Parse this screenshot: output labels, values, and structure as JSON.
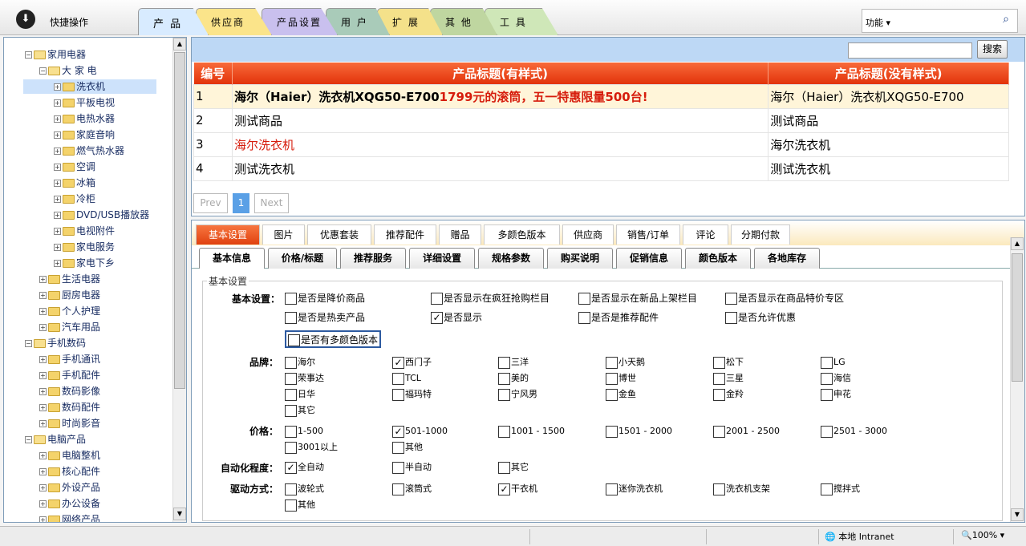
{
  "toolbar": {
    "quick_label": "快捷操作",
    "function_label": "功能 ▾",
    "search_icon": "search-icon"
  },
  "tabs": [
    {
      "label": "产 品",
      "color": "#d8ebff"
    },
    {
      "label": "供应商",
      "color": "#fbe48a"
    },
    {
      "label": "产品设置",
      "color": "#c9c0ee"
    },
    {
      "label": "用 户",
      "color": "#a9cbb9"
    },
    {
      "label": "扩 展",
      "color": "#f4e18a"
    },
    {
      "label": "其 他",
      "color": "#bfd6a0"
    },
    {
      "label": "工 具",
      "color": "#cfe7b8"
    }
  ],
  "tree": {
    "items": [
      {
        "label": "家用电器",
        "level": 0
      },
      {
        "label": "大 家 电",
        "level": 1
      },
      {
        "label": "洗衣机",
        "level": 2
      },
      {
        "label": "平板电视",
        "level": 2
      },
      {
        "label": "电热水器",
        "level": 2
      },
      {
        "label": "家庭音响",
        "level": 2
      },
      {
        "label": "燃气热水器",
        "level": 2
      },
      {
        "label": "空调",
        "level": 2
      },
      {
        "label": "冰箱",
        "level": 2
      },
      {
        "label": "冷柜",
        "level": 2
      },
      {
        "label": "DVD/USB播放器",
        "level": 2
      },
      {
        "label": "电视附件",
        "level": 2
      },
      {
        "label": "家电服务",
        "level": 2
      },
      {
        "label": "家电下乡",
        "level": 2
      },
      {
        "label": "生活电器",
        "level": 1
      },
      {
        "label": "厨房电器",
        "level": 1
      },
      {
        "label": "个人护理",
        "level": 1
      },
      {
        "label": "汽车用品",
        "level": 1
      },
      {
        "label": "手机数码",
        "level": 0
      },
      {
        "label": "手机通讯",
        "level": 1
      },
      {
        "label": "手机配件",
        "level": 1
      },
      {
        "label": "数码影像",
        "level": 1
      },
      {
        "label": "数码配件",
        "level": 1
      },
      {
        "label": "时尚影音",
        "level": 1
      },
      {
        "label": "电脑产品",
        "level": 0
      },
      {
        "label": "电脑整机",
        "level": 1
      },
      {
        "label": "核心配件",
        "level": 1
      },
      {
        "label": "外设产品",
        "level": 1
      },
      {
        "label": "办公设备",
        "level": 1
      },
      {
        "label": "网络产品",
        "level": 1
      }
    ]
  },
  "search": {
    "button": "搜索",
    "value": ""
  },
  "product_table": {
    "headers": [
      "编号",
      "产品标题(有样式)",
      "产品标题(没有样式)"
    ],
    "rows": [
      {
        "id": "1",
        "styled_a": "海尔（Haier）洗衣机XQG50-E700",
        "styled_b": "1799元的滚筒，五一特惠限量500台!",
        "plain": "海尔（Haier）洗衣机XQG50-E700"
      },
      {
        "id": "2",
        "styled_a": "测试商品",
        "styled_b": "",
        "plain": "测试商品"
      },
      {
        "id": "3",
        "styled_a": "海尔洗衣机",
        "styled_b": "",
        "plain": "海尔洗衣机"
      },
      {
        "id": "4",
        "styled_a": "测试洗衣机",
        "styled_b": "",
        "plain": "测试洗衣机"
      }
    ]
  },
  "pager": {
    "prev": "Prev",
    "current": "1",
    "next": "Next"
  },
  "detail_tabs_top": [
    "基本设置",
    "图片",
    "优惠套装",
    "推荐配件",
    "赠品",
    "多颜色版本",
    "供应商",
    "销售/订单",
    "评论",
    "分期付款"
  ],
  "detail_tabs_sub": [
    "基本信息",
    "价格/标题",
    "推荐服务",
    "详细设置",
    "规格参数",
    "购买说明",
    "促销信息",
    "颜色版本",
    "各地库存"
  ],
  "form": {
    "legend": "基本设置",
    "basic_label": "基本设置：",
    "basic": [
      {
        "label": "是否是降价商品",
        "checked": false
      },
      {
        "label": "是否显示在疯狂抢购栏目",
        "checked": false
      },
      {
        "label": "是否显示在新品上架栏目",
        "checked": false
      },
      {
        "label": "是否显示在商品特价专区",
        "checked": false
      },
      {
        "label": "是否是热卖产品",
        "checked": false
      },
      {
        "label": "是否显示",
        "checked": true
      },
      {
        "label": "是否是推荐配件",
        "checked": false
      },
      {
        "label": "是否允许优惠",
        "checked": false
      },
      {
        "label": "是否有多颜色版本",
        "checked": false
      }
    ],
    "brand_label": "品牌：",
    "brands": [
      {
        "label": "海尔",
        "checked": false
      },
      {
        "label": "西门子",
        "checked": true
      },
      {
        "label": "三洋",
        "checked": false
      },
      {
        "label": "小天鹅",
        "checked": false
      },
      {
        "label": "松下",
        "checked": false
      },
      {
        "label": "LG",
        "checked": false
      },
      {
        "label": "荣事达",
        "checked": false
      },
      {
        "label": "TCL",
        "checked": false
      },
      {
        "label": "美的",
        "checked": false
      },
      {
        "label": "博世",
        "checked": false
      },
      {
        "label": "三星",
        "checked": false
      },
      {
        "label": "海信",
        "checked": false
      },
      {
        "label": "日华",
        "checked": false
      },
      {
        "label": "福玛特",
        "checked": false
      },
      {
        "label": "宁风男",
        "checked": false
      },
      {
        "label": "金鱼",
        "checked": false
      },
      {
        "label": "金羚",
        "checked": false
      },
      {
        "label": "申花",
        "checked": false
      },
      {
        "label": "其它",
        "checked": false
      }
    ],
    "price_label": "价格：",
    "prices": [
      {
        "label": "1-500",
        "checked": false
      },
      {
        "label": "501-1000",
        "checked": true
      },
      {
        "label": "1001 - 1500",
        "checked": false
      },
      {
        "label": "1501 - 2000",
        "checked": false
      },
      {
        "label": "2001 - 2500",
        "checked": false
      },
      {
        "label": "2501 - 3000",
        "checked": false
      },
      {
        "label": "3001以上",
        "checked": false
      },
      {
        "label": "其他",
        "checked": false
      }
    ],
    "auto_label": "自动化程度：",
    "auto": [
      {
        "label": "全自动",
        "checked": true
      },
      {
        "label": "半自动",
        "checked": false
      },
      {
        "label": "其它",
        "checked": false
      }
    ],
    "drive_label": "驱动方式：",
    "drive": [
      {
        "label": "波轮式",
        "checked": false
      },
      {
        "label": "滚筒式",
        "checked": false
      },
      {
        "label": "干衣机",
        "checked": true
      },
      {
        "label": "迷你洗衣机",
        "checked": false
      },
      {
        "label": "洗衣机支架",
        "checked": false
      },
      {
        "label": "搅拌式",
        "checked": false
      },
      {
        "label": "其他",
        "checked": false
      }
    ]
  },
  "status": {
    "zone": "本地 Intranet",
    "zoom": "100%"
  }
}
